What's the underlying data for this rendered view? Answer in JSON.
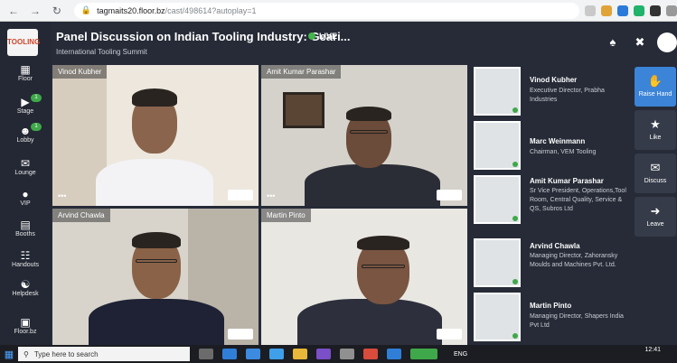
{
  "browser": {
    "url_host": "tagmaits20.floor.bz",
    "url_path": "/cast/498614?autoplay=1"
  },
  "header": {
    "title": "Panel Discussion on Indian Tooling Industry: Geari...",
    "live_label": "LIVE",
    "subtitle": "International Tooling Summit"
  },
  "sidebar": {
    "logo_text": "TOOLING",
    "items": [
      {
        "label": "Floor",
        "icon": "map-icon"
      },
      {
        "label": "Stage",
        "icon": "video-icon",
        "badge": "1"
      },
      {
        "label": "Lobby",
        "icon": "people-icon",
        "badge": "1"
      },
      {
        "label": "Lounge",
        "icon": "chat-icon"
      },
      {
        "label": "VIP",
        "icon": "mic-icon"
      },
      {
        "label": "Booths",
        "icon": "booth-icon"
      },
      {
        "label": "Handouts",
        "icon": "document-icon"
      },
      {
        "label": "Helpdesk",
        "icon": "helpdesk-icon"
      },
      {
        "label": "Floor.bz",
        "icon": "floorbz-icon"
      }
    ]
  },
  "video_tiles": [
    {
      "name": "Vinod Kubher"
    },
    {
      "name": "Amit Kumar Parashar"
    },
    {
      "name": "Arvind Chawla"
    },
    {
      "name": "Martin Pinto"
    }
  ],
  "participants": [
    {
      "name": "Vinod Kubher",
      "role": "Executive Director, Prabha Industries"
    },
    {
      "name": "Marc Weinmann",
      "role": "Chairman, VEM Tooling"
    },
    {
      "name": "Amit Kumar Parashar",
      "role": "Sr Vice President, Operations,Tool Room, Central Quality, Service & QS, Subros Ltd"
    },
    {
      "name": "Arvind Chawla",
      "role": "Managing Director, Zahoransky Moulds and Machines Pvt. Ltd."
    },
    {
      "name": "Martin Pinto",
      "role": "Managing Director, Shapers India Pvt Ltd"
    }
  ],
  "actions": [
    {
      "label": "Raise Hand",
      "icon": "hand-icon"
    },
    {
      "label": "Like",
      "icon": "thumbs-up-icon"
    },
    {
      "label": "Discuss",
      "icon": "comment-icon"
    },
    {
      "label": "Leave",
      "icon": "exit-icon"
    }
  ],
  "taskbar": {
    "search_placeholder": "Type here to search",
    "time": "12:41",
    "lang": "ENG"
  },
  "colors": {
    "app_bg": "#262b37",
    "live_green": "#43b54b",
    "action_bg": "#353b49"
  }
}
